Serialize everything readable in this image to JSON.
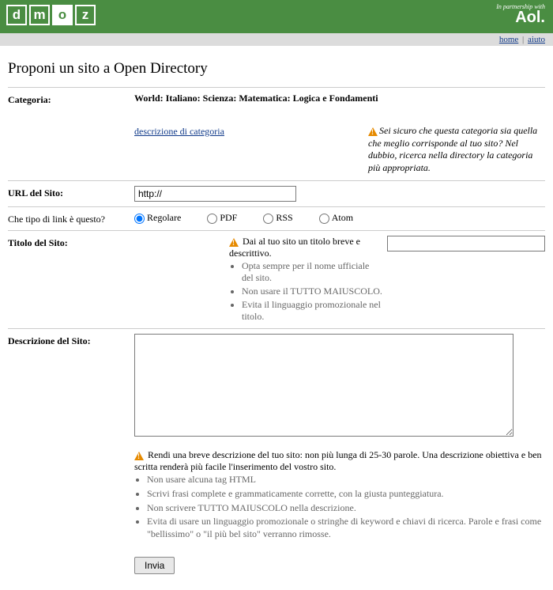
{
  "header": {
    "logo_letters": [
      "d",
      "m",
      "o",
      "z"
    ],
    "partnership_small": "In partnership with",
    "partnership_brand": "Aol."
  },
  "nav": {
    "home": "home",
    "aiuto": "aiuto"
  },
  "page_title": "Proponi un sito a Open Directory",
  "category": {
    "label": "Categoria:",
    "path": "World: Italiano: Scienza: Matematica: Logica e Fondamenti",
    "link_text": "descrizione di categoria",
    "warning": "Sei sicuro che questa categoria sia quella che meglio corrisponde al tuo sito? Nel dubbio, ricerca nella directory la categoria più appropriata."
  },
  "url": {
    "label": "URL del Sito:",
    "value": "http://"
  },
  "linktype": {
    "label": "Che tipo di link è questo?",
    "options": {
      "regolare": "Regolare",
      "pdf": "PDF",
      "rss": "RSS",
      "atom": "Atom"
    }
  },
  "title_field": {
    "label": "Titolo del Sito:",
    "lead": "Dai al tuo sito un titolo breve e descrittivo.",
    "tips": [
      "Opta sempre per il nome ufficiale del sito.",
      "Non usare il TUTTO MAIUSCOLO.",
      "Evita il linguaggio promozionale nel titolo."
    ]
  },
  "description": {
    "label": "Descrizione del Sito:",
    "lead": "Rendi una breve descrizione del tuo sito: non più lunga di 25-30 parole.  Una descrizione obiettiva e ben scritta renderà più facile l'inserimento del vostro sito.",
    "tips": [
      "Non usare alcuna tag HTML",
      "Scrivi frasi complete e grammaticamente corrette, con la giusta punteggiatura.",
      "Non scrivere TUTTO MAIUSCOLO nella descrizione.",
      "Evita di usare un linguaggio promozionale o stringhe di keyword e chiavi di ricerca. Parole e frasi come \"bellissimo\" o \"il più bel sito\" verranno rimosse."
    ]
  },
  "submit_label": "Invia"
}
